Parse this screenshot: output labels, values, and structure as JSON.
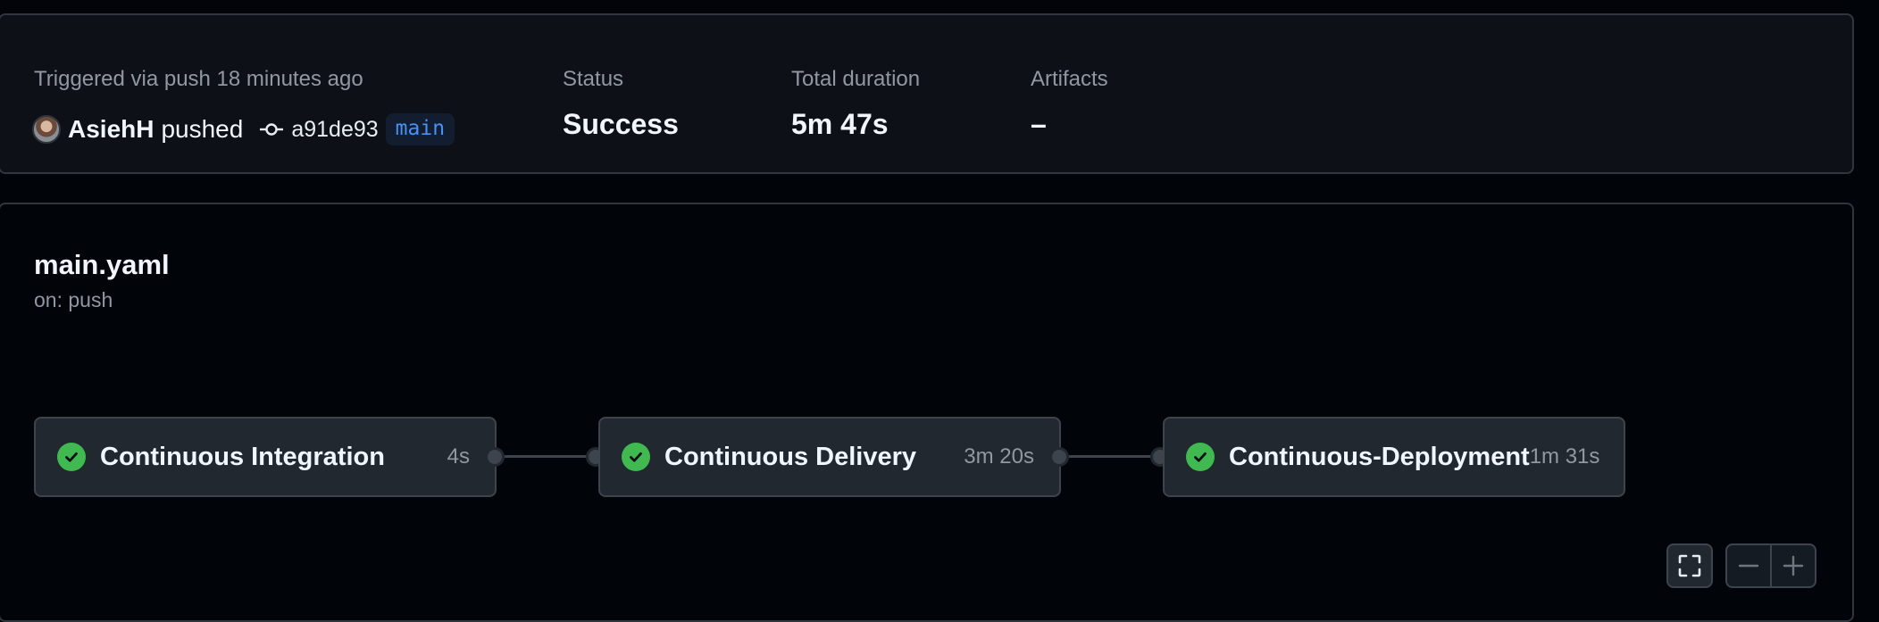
{
  "summary": {
    "trigger_text": "Triggered via push 18 minutes ago",
    "actor": "AsiehH",
    "action": "pushed",
    "commit_sha": "a91de93",
    "branch": "main",
    "status_label": "Status",
    "status_value": "Success",
    "duration_label": "Total duration",
    "duration_value": "5m 47s",
    "artifacts_label": "Artifacts",
    "artifacts_value": "–"
  },
  "workflow": {
    "file": "main.yaml",
    "trigger": "on: push",
    "jobs": [
      {
        "name": "Continuous Integration",
        "duration": "4s",
        "status": "success"
      },
      {
        "name": "Continuous Delivery",
        "duration": "3m 20s",
        "status": "success"
      },
      {
        "name": "Continuous-Deployment",
        "duration": "1m 31s",
        "status": "success"
      }
    ]
  },
  "icons": {
    "status": "check-circle-icon",
    "commit": "git-commit-icon",
    "fullscreen": "fullscreen-icon",
    "zoom_out": "zoom-out-icon",
    "zoom_in": "zoom-in-icon"
  },
  "colors": {
    "success": "#3fb950",
    "branch_text": "#4493f8",
    "background": "#010409",
    "card": "#0d1117",
    "border": "#30363d"
  }
}
